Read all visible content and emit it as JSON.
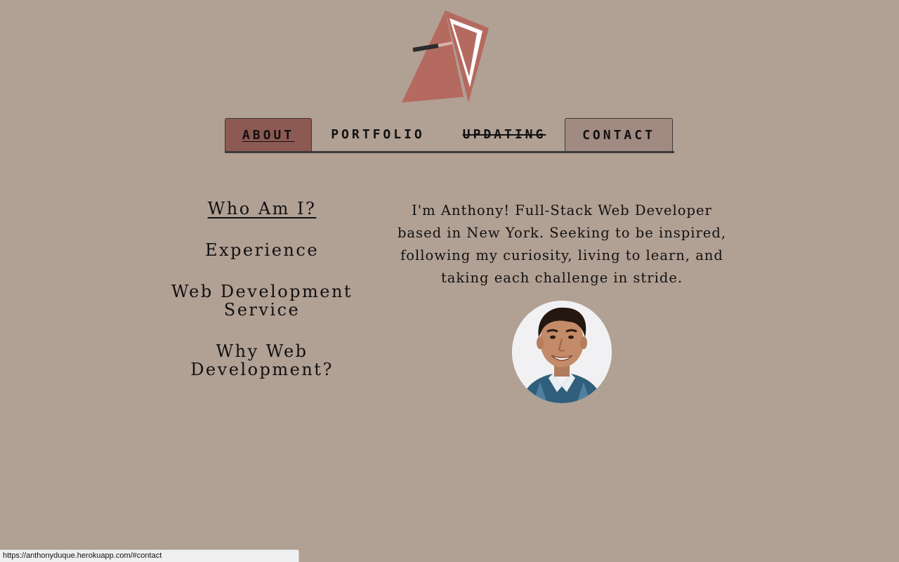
{
  "logo": {
    "icon": "triangle-monogram-logo",
    "colors": {
      "fill": "#b56a5f",
      "outline": "#b56a5f",
      "inner": "#ffffff",
      "bar": "#2b2b2b"
    }
  },
  "nav": {
    "tabs": [
      {
        "label": "ABOUT",
        "state": "active"
      },
      {
        "label": "PORTFOLIO",
        "state": "normal"
      },
      {
        "label": "UPDATING",
        "state": "disabled"
      },
      {
        "label": "CONTACT",
        "state": "hover"
      }
    ]
  },
  "side_menu": {
    "items": [
      {
        "label": "Who Am I?",
        "active": true
      },
      {
        "label": "Experience",
        "active": false
      },
      {
        "label": "Web Development Service",
        "active": false
      },
      {
        "label": "Why Web Development?",
        "active": false
      }
    ]
  },
  "intro": {
    "text": "I'm Anthony! Full-Stack Web Developer based in New York. Seeking to be inspired, following my curiosity, living to learn, and taking each challenge in stride."
  },
  "avatar": {
    "icon": "profile-photo"
  },
  "status_bar": {
    "url": "https://anthonyduque.herokuapp.com/#contact"
  },
  "colors": {
    "background": "#b1a094",
    "tab_active": "#8c5a53",
    "tab_hover": "#a08a81",
    "nav_border": "#3d3a39"
  }
}
